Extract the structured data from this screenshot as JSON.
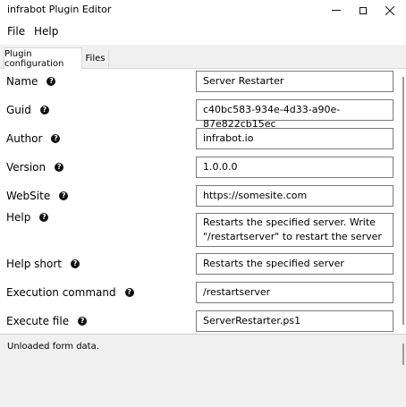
{
  "window": {
    "title": "infrabot Plugin Editor"
  },
  "menu": {
    "file": "File",
    "help": "Help"
  },
  "tabs": {
    "plugin_configuration": "Plugin configuration",
    "files": "Files"
  },
  "form": {
    "name": {
      "label": "Name",
      "value": "Server Restarter"
    },
    "guid": {
      "label": "Guid",
      "value": "c40bc583-934e-4d33-a90e-87e822cb15ec"
    },
    "author": {
      "label": "Author",
      "value": "infrabot.io"
    },
    "version": {
      "label": "Version",
      "value": "1.0.0.0"
    },
    "website": {
      "label": "WebSite",
      "value": "https://somesite.com"
    },
    "help": {
      "label": "Help",
      "value": "Restarts the specified server. Write \"/restartserver\" to restart the server"
    },
    "help_short": {
      "label": "Help short",
      "value": "Restarts the specified server"
    },
    "execution_command": {
      "label": "Execution command",
      "value": "/restartserver"
    },
    "execute_file": {
      "label": "Execute file",
      "value": "ServerRestarter.ps1"
    }
  },
  "help_icon_glyph": "?",
  "status": {
    "text": "Unloaded form data."
  }
}
